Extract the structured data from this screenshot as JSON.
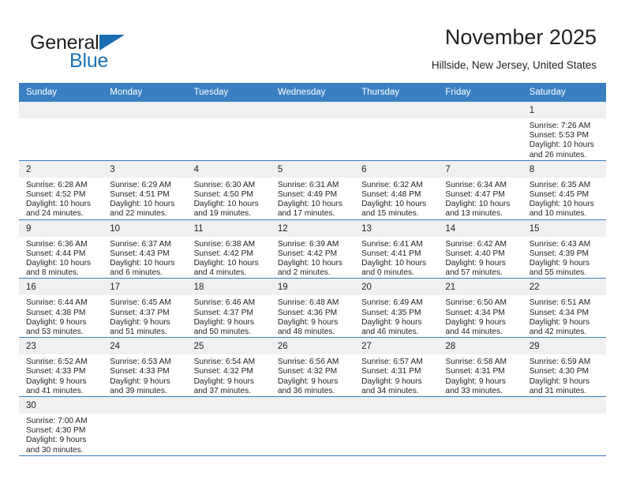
{
  "brand": {
    "name_part1": "General",
    "name_part2": "Blue",
    "logo_icon": "blue-triangle-logo"
  },
  "header": {
    "title": "November 2025",
    "subtitle": "Hillside, New Jersey, United States"
  },
  "colors": {
    "header_blue": "#3a7fc1",
    "daynum_background": "#f0f0f0",
    "text": "#231f20",
    "brand_blue": "#1b72b8"
  },
  "calendar": {
    "weekday_headers": [
      "Sunday",
      "Monday",
      "Tuesday",
      "Wednesday",
      "Thursday",
      "Friday",
      "Saturday"
    ],
    "labels": {
      "sunrise": "Sunrise:",
      "sunset": "Sunset:",
      "daylight": "Daylight:"
    },
    "weeks": [
      [
        {
          "day": ""
        },
        {
          "day": ""
        },
        {
          "day": ""
        },
        {
          "day": ""
        },
        {
          "day": ""
        },
        {
          "day": ""
        },
        {
          "day": "1",
          "sunrise": "Sunrise: 7:26 AM",
          "sunset": "Sunset: 5:53 PM",
          "daylight1": "Daylight: 10 hours",
          "daylight2": "and 26 minutes."
        }
      ],
      [
        {
          "day": "2",
          "sunrise": "Sunrise: 6:28 AM",
          "sunset": "Sunset: 4:52 PM",
          "daylight1": "Daylight: 10 hours",
          "daylight2": "and 24 minutes."
        },
        {
          "day": "3",
          "sunrise": "Sunrise: 6:29 AM",
          "sunset": "Sunset: 4:51 PM",
          "daylight1": "Daylight: 10 hours",
          "daylight2": "and 22 minutes."
        },
        {
          "day": "4",
          "sunrise": "Sunrise: 6:30 AM",
          "sunset": "Sunset: 4:50 PM",
          "daylight1": "Daylight: 10 hours",
          "daylight2": "and 19 minutes."
        },
        {
          "day": "5",
          "sunrise": "Sunrise: 6:31 AM",
          "sunset": "Sunset: 4:49 PM",
          "daylight1": "Daylight: 10 hours",
          "daylight2": "and 17 minutes."
        },
        {
          "day": "6",
          "sunrise": "Sunrise: 6:32 AM",
          "sunset": "Sunset: 4:48 PM",
          "daylight1": "Daylight: 10 hours",
          "daylight2": "and 15 minutes."
        },
        {
          "day": "7",
          "sunrise": "Sunrise: 6:34 AM",
          "sunset": "Sunset: 4:47 PM",
          "daylight1": "Daylight: 10 hours",
          "daylight2": "and 13 minutes."
        },
        {
          "day": "8",
          "sunrise": "Sunrise: 6:35 AM",
          "sunset": "Sunset: 4:45 PM",
          "daylight1": "Daylight: 10 hours",
          "daylight2": "and 10 minutes."
        }
      ],
      [
        {
          "day": "9",
          "sunrise": "Sunrise: 6:36 AM",
          "sunset": "Sunset: 4:44 PM",
          "daylight1": "Daylight: 10 hours",
          "daylight2": "and 8 minutes."
        },
        {
          "day": "10",
          "sunrise": "Sunrise: 6:37 AM",
          "sunset": "Sunset: 4:43 PM",
          "daylight1": "Daylight: 10 hours",
          "daylight2": "and 6 minutes."
        },
        {
          "day": "11",
          "sunrise": "Sunrise: 6:38 AM",
          "sunset": "Sunset: 4:42 PM",
          "daylight1": "Daylight: 10 hours",
          "daylight2": "and 4 minutes."
        },
        {
          "day": "12",
          "sunrise": "Sunrise: 6:39 AM",
          "sunset": "Sunset: 4:42 PM",
          "daylight1": "Daylight: 10 hours",
          "daylight2": "and 2 minutes."
        },
        {
          "day": "13",
          "sunrise": "Sunrise: 6:41 AM",
          "sunset": "Sunset: 4:41 PM",
          "daylight1": "Daylight: 10 hours",
          "daylight2": "and 0 minutes."
        },
        {
          "day": "14",
          "sunrise": "Sunrise: 6:42 AM",
          "sunset": "Sunset: 4:40 PM",
          "daylight1": "Daylight: 9 hours",
          "daylight2": "and 57 minutes."
        },
        {
          "day": "15",
          "sunrise": "Sunrise: 6:43 AM",
          "sunset": "Sunset: 4:39 PM",
          "daylight1": "Daylight: 9 hours",
          "daylight2": "and 55 minutes."
        }
      ],
      [
        {
          "day": "16",
          "sunrise": "Sunrise: 6:44 AM",
          "sunset": "Sunset: 4:38 PM",
          "daylight1": "Daylight: 9 hours",
          "daylight2": "and 53 minutes."
        },
        {
          "day": "17",
          "sunrise": "Sunrise: 6:45 AM",
          "sunset": "Sunset: 4:37 PM",
          "daylight1": "Daylight: 9 hours",
          "daylight2": "and 51 minutes."
        },
        {
          "day": "18",
          "sunrise": "Sunrise: 6:46 AM",
          "sunset": "Sunset: 4:37 PM",
          "daylight1": "Daylight: 9 hours",
          "daylight2": "and 50 minutes."
        },
        {
          "day": "19",
          "sunrise": "Sunrise: 6:48 AM",
          "sunset": "Sunset: 4:36 PM",
          "daylight1": "Daylight: 9 hours",
          "daylight2": "and 48 minutes."
        },
        {
          "day": "20",
          "sunrise": "Sunrise: 6:49 AM",
          "sunset": "Sunset: 4:35 PM",
          "daylight1": "Daylight: 9 hours",
          "daylight2": "and 46 minutes."
        },
        {
          "day": "21",
          "sunrise": "Sunrise: 6:50 AM",
          "sunset": "Sunset: 4:34 PM",
          "daylight1": "Daylight: 9 hours",
          "daylight2": "and 44 minutes."
        },
        {
          "day": "22",
          "sunrise": "Sunrise: 6:51 AM",
          "sunset": "Sunset: 4:34 PM",
          "daylight1": "Daylight: 9 hours",
          "daylight2": "and 42 minutes."
        }
      ],
      [
        {
          "day": "23",
          "sunrise": "Sunrise: 6:52 AM",
          "sunset": "Sunset: 4:33 PM",
          "daylight1": "Daylight: 9 hours",
          "daylight2": "and 41 minutes."
        },
        {
          "day": "24",
          "sunrise": "Sunrise: 6:53 AM",
          "sunset": "Sunset: 4:33 PM",
          "daylight1": "Daylight: 9 hours",
          "daylight2": "and 39 minutes."
        },
        {
          "day": "25",
          "sunrise": "Sunrise: 6:54 AM",
          "sunset": "Sunset: 4:32 PM",
          "daylight1": "Daylight: 9 hours",
          "daylight2": "and 37 minutes."
        },
        {
          "day": "26",
          "sunrise": "Sunrise: 6:56 AM",
          "sunset": "Sunset: 4:32 PM",
          "daylight1": "Daylight: 9 hours",
          "daylight2": "and 36 minutes."
        },
        {
          "day": "27",
          "sunrise": "Sunrise: 6:57 AM",
          "sunset": "Sunset: 4:31 PM",
          "daylight1": "Daylight: 9 hours",
          "daylight2": "and 34 minutes."
        },
        {
          "day": "28",
          "sunrise": "Sunrise: 6:58 AM",
          "sunset": "Sunset: 4:31 PM",
          "daylight1": "Daylight: 9 hours",
          "daylight2": "and 33 minutes."
        },
        {
          "day": "29",
          "sunrise": "Sunrise: 6:59 AM",
          "sunset": "Sunset: 4:30 PM",
          "daylight1": "Daylight: 9 hours",
          "daylight2": "and 31 minutes."
        }
      ],
      [
        {
          "day": "30",
          "sunrise": "Sunrise: 7:00 AM",
          "sunset": "Sunset: 4:30 PM",
          "daylight1": "Daylight: 9 hours",
          "daylight2": "and 30 minutes."
        },
        {
          "day": ""
        },
        {
          "day": ""
        },
        {
          "day": ""
        },
        {
          "day": ""
        },
        {
          "day": ""
        },
        {
          "day": ""
        }
      ]
    ]
  }
}
